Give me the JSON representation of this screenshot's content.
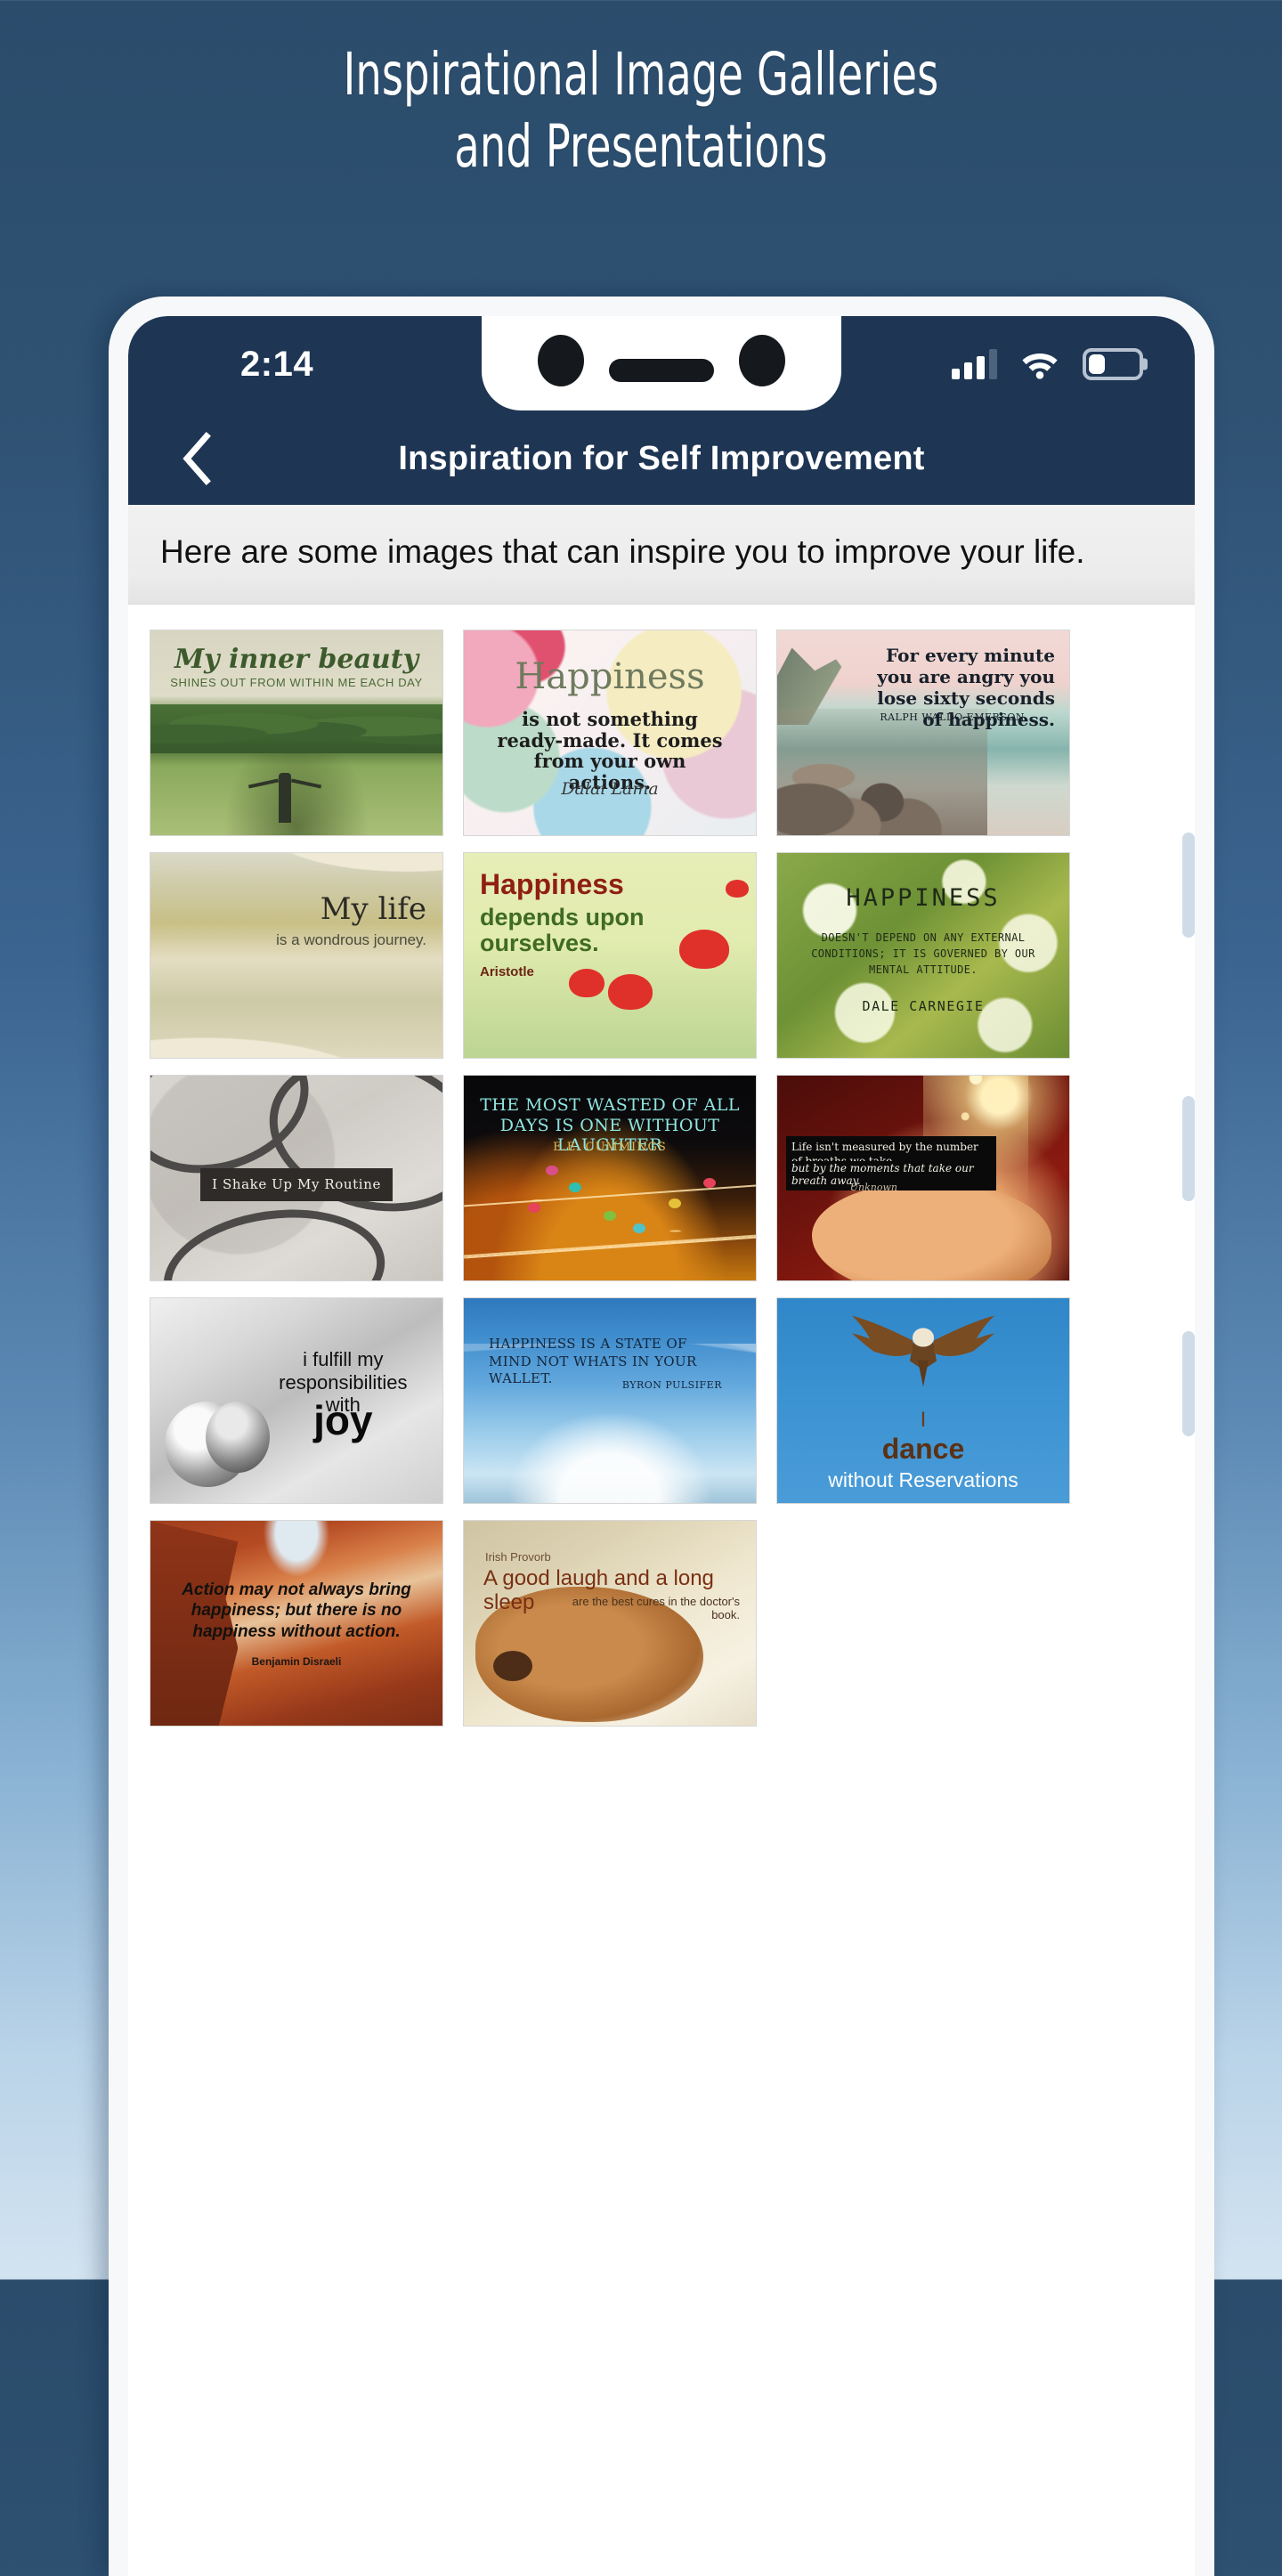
{
  "hero": {
    "line1": "Inspirational Image Galleries",
    "line2": "and Presentations"
  },
  "phone": {
    "status_bar": {
      "time": "2:14",
      "signal_icon": "signal-bars-icon",
      "wifi_icon": "wifi-icon",
      "battery_icon": "battery-icon",
      "battery_level_percent": 33
    },
    "nav_bar": {
      "back_icon": "chevron-left-icon",
      "title": "Inspiration for Self Improvement"
    },
    "description": "Here are some images that can inspire you to improve your life."
  },
  "colors": {
    "page_background_top": "#2b4c6b",
    "page_background_bottom": "#d3e4f1",
    "nav_bar": "#1e3553",
    "status_bar": "#1e3553",
    "phone_body": "#f7f8fa",
    "description_background": "#ececec",
    "scrollbar": "#cfdce8"
  },
  "gallery": {
    "items": [
      {
        "id": "inner-beauty",
        "art": "art-field",
        "headline": "My inner beauty",
        "subline": "SHINES OUT FROM WITHIN ME EACH DAY",
        "author": ""
      },
      {
        "id": "dalai-lama-happiness",
        "art": "art-balloons",
        "headline": "Happiness",
        "subline": "is not something ready-made. It comes from your own actions.",
        "author": "Dalai Lama"
      },
      {
        "id": "emerson-angry",
        "art": "art-sea",
        "headline": "For every minute you are angry you lose sixty seconds of happiness.",
        "subline": "",
        "author": "RALPH WALDO EMERSON"
      },
      {
        "id": "wondrous-journey",
        "art": "art-path",
        "headline": "My life",
        "subline": "is a wondrous journey.",
        "author": ""
      },
      {
        "id": "aristotle-happiness",
        "art": "art-poppy",
        "headline": "Happiness",
        "subline": "depends upon ourselves.",
        "author": "Aristotle"
      },
      {
        "id": "carnegie-happiness",
        "art": "art-daisy",
        "headline": "HAPPINESS",
        "subline": "DOESN'T DEPEND ON ANY EXTERNAL CONDITIONS; IT IS GOVERNED BY OUR MENTAL ATTITUDE.",
        "author": "DALE CARNEGIE"
      },
      {
        "id": "shake-up-routine",
        "art": "art-cables",
        "headline": "I Shake Up My Routine",
        "subline": "",
        "author": ""
      },
      {
        "id": "cummings-laughter",
        "art": "art-music",
        "headline": "THE MOST WASTED OF ALL DAYS IS ONE WITHOUT LAUGHTER",
        "subline": "",
        "author": "E.E. CUMMINGS"
      },
      {
        "id": "breaths-we-take",
        "art": "art-hand",
        "headline": "Life isn't measured by the number of breaths we take,",
        "subline": "but by the moments that take our breath away.",
        "author": "Unknown"
      },
      {
        "id": "responsibilities-joy",
        "art": "art-head",
        "headline": "i fulfill my responsibilities with",
        "subline": "joy",
        "author": ""
      },
      {
        "id": "pulsifer-state-of-mind",
        "art": "art-sky",
        "headline": "HAPPINESS IS A STATE OF MIND NOT WHATS IN YOUR WALLET.",
        "subline": "",
        "author": "BYRON PULSIFER"
      },
      {
        "id": "dance-without-reservations",
        "art": "art-eagle",
        "headline": "I",
        "subline": "dance",
        "author": "without Reservations"
      },
      {
        "id": "disraeli-action",
        "art": "art-canyon",
        "headline": "Action may not always bring happiness; but there is no happiness without action.",
        "subline": "",
        "author": "Benjamin Disraeli"
      },
      {
        "id": "irish-proverb-laugh",
        "art": "art-dog",
        "headline": "A good laugh and a long sleep",
        "subline": "are the best cures in the doctor's book.",
        "author": "Irish Provorb"
      }
    ]
  }
}
